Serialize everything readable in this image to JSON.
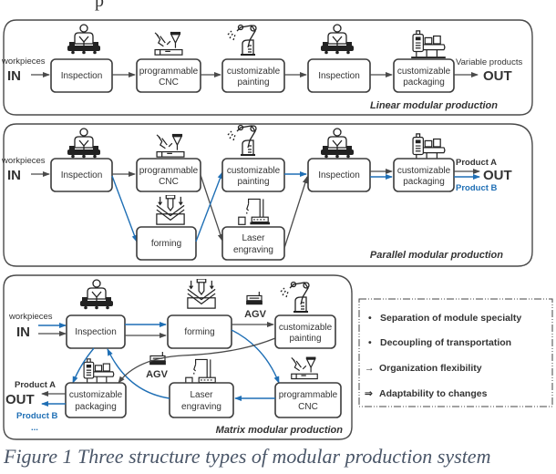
{
  "figure": {
    "caption": "Figure 1 Three structure types of modular production system",
    "top_fragment": "p"
  },
  "colors": {
    "blue": "#1f6fb5",
    "gray": "#4a4a4a"
  },
  "panels": {
    "linear": {
      "title": "Linear modular production",
      "input_label": "workpieces",
      "in": "IN",
      "output_label": "Variable products",
      "out": "OUT",
      "modules": [
        {
          "line1": "Inspection",
          "line2": "",
          "icon": "inspector-icon"
        },
        {
          "line1": "programmable",
          "line2": "CNC",
          "icon": "cnc-icon"
        },
        {
          "line1": "customizable",
          "line2": "painting",
          "icon": "robot-arm-spray-icon"
        },
        {
          "line1": "Inspection",
          "line2": "",
          "icon": "inspector-icon"
        },
        {
          "line1": "customizable",
          "line2": "packaging",
          "icon": "packaging-machine-icon"
        }
      ]
    },
    "parallel": {
      "title": "Parallel modular production",
      "input_label": "workpieces",
      "in": "IN",
      "out": "OUT",
      "product_a": "Product A",
      "product_b": "Product B",
      "modules": [
        {
          "line1": "Inspection",
          "line2": "",
          "icon": "inspector-icon"
        },
        {
          "line1": "programmable",
          "line2": "CNC",
          "icon": "cnc-icon"
        },
        {
          "line1": "forming",
          "line2": "",
          "icon": "press-brake-icon"
        },
        {
          "line1": "customizable",
          "line2": "painting",
          "icon": "robot-arm-spray-icon"
        },
        {
          "line1": "Laser",
          "line2": "engraving",
          "icon": "laser-robot-icon"
        },
        {
          "line1": "Inspection",
          "line2": "",
          "icon": "inspector-icon"
        },
        {
          "line1": "customizable",
          "line2": "packaging",
          "icon": "packaging-machine-icon"
        }
      ]
    },
    "matrix": {
      "title": "Matrix modular production",
      "input_label": "workpieces",
      "in": "IN",
      "out": "OUT",
      "product_a": "Product A",
      "product_b": "Product B",
      "ellipsis": "...",
      "agv": "AGV",
      "modules": [
        {
          "line1": "Inspection",
          "line2": "",
          "icon": "inspector-icon"
        },
        {
          "line1": "forming",
          "line2": "",
          "icon": "press-brake-icon"
        },
        {
          "line1": "customizable",
          "line2": "painting",
          "icon": "robot-arm-spray-icon"
        },
        {
          "line1": "programmable",
          "line2": "CNC",
          "icon": "cnc-icon"
        },
        {
          "line1": "Laser",
          "line2": "engraving",
          "icon": "laser-robot-icon"
        },
        {
          "line1": "customizable",
          "line2": "packaging",
          "icon": "packaging-machine-icon"
        }
      ]
    }
  },
  "legend": {
    "items": [
      {
        "marker": "•",
        "text": "Separation of module specialty"
      },
      {
        "marker": "•",
        "text": "Decoupling of transportation"
      },
      {
        "marker": "→",
        "text": "Organization flexibility"
      },
      {
        "marker": "⇒",
        "text": "Adaptability to changes"
      }
    ]
  }
}
